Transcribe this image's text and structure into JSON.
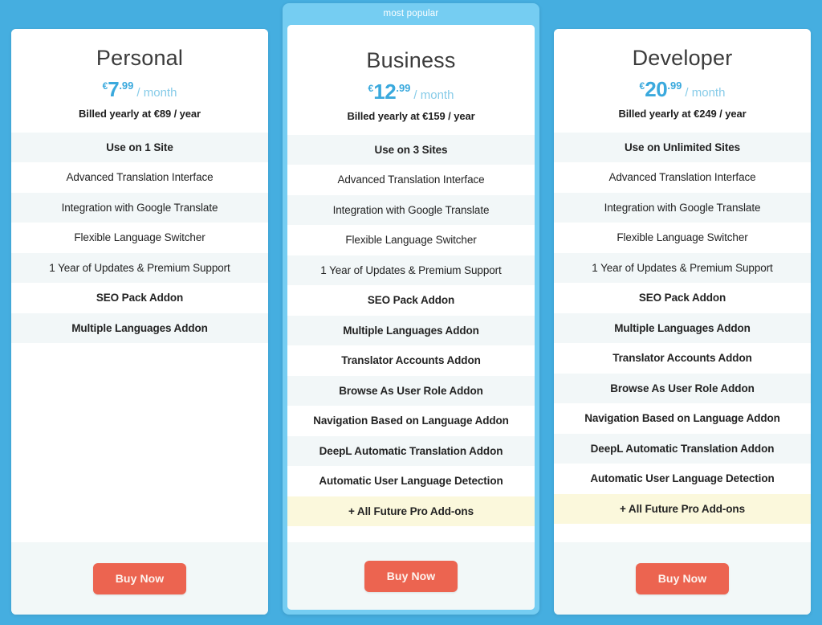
{
  "background_color": "#45aee0",
  "accent_color": "#3aa9dd",
  "buy_button_color": "#ec6450",
  "highlight_row_color": "#fbf8dc",
  "featured_frame_color": "#75cdf2",
  "plans": [
    {
      "name": "Personal",
      "featured": false,
      "badge": "",
      "currency": "€",
      "price_int": "7",
      "price_dec": ".99",
      "period": "/ month",
      "billing": "Billed yearly at €89 / year",
      "buy_label": "Buy Now",
      "features": [
        {
          "label": "Use on 1 Site",
          "bold": true,
          "highlight": false
        },
        {
          "label": "Advanced Translation Interface",
          "bold": false,
          "highlight": false
        },
        {
          "label": "Integration with Google Translate",
          "bold": false,
          "highlight": false
        },
        {
          "label": "Flexible Language Switcher",
          "bold": false,
          "highlight": false
        },
        {
          "label": "1 Year of Updates & Premium Support",
          "bold": false,
          "highlight": false
        },
        {
          "label": "SEO Pack Addon",
          "bold": true,
          "highlight": false
        },
        {
          "label": "Multiple Languages Addon",
          "bold": true,
          "highlight": false
        }
      ]
    },
    {
      "name": "Business",
      "featured": true,
      "badge": "most popular",
      "currency": "€",
      "price_int": "12",
      "price_dec": ".99",
      "period": "/ month",
      "billing": "Billed yearly at €159 / year",
      "buy_label": "Buy Now",
      "features": [
        {
          "label": "Use on 3 Sites",
          "bold": true,
          "highlight": false
        },
        {
          "label": "Advanced Translation Interface",
          "bold": false,
          "highlight": false
        },
        {
          "label": "Integration with Google Translate",
          "bold": false,
          "highlight": false
        },
        {
          "label": "Flexible Language Switcher",
          "bold": false,
          "highlight": false
        },
        {
          "label": "1 Year of Updates & Premium Support",
          "bold": false,
          "highlight": false
        },
        {
          "label": "SEO Pack Addon",
          "bold": true,
          "highlight": false
        },
        {
          "label": "Multiple Languages Addon",
          "bold": true,
          "highlight": false
        },
        {
          "label": "Translator Accounts Addon",
          "bold": true,
          "highlight": false
        },
        {
          "label": "Browse As User Role Addon",
          "bold": true,
          "highlight": false
        },
        {
          "label": "Navigation Based on Language Addon",
          "bold": true,
          "highlight": false
        },
        {
          "label": "DeepL Automatic Translation Addon",
          "bold": true,
          "highlight": false
        },
        {
          "label": "Automatic User Language Detection",
          "bold": true,
          "highlight": false
        },
        {
          "label": "+ All Future Pro Add-ons",
          "bold": true,
          "highlight": true
        }
      ]
    },
    {
      "name": "Developer",
      "featured": false,
      "badge": "",
      "currency": "€",
      "price_int": "20",
      "price_dec": ".99",
      "period": "/ month",
      "billing": "Billed yearly at €249 / year",
      "buy_label": "Buy Now",
      "features": [
        {
          "label": "Use on Unlimited Sites",
          "bold": true,
          "highlight": false
        },
        {
          "label": "Advanced Translation Interface",
          "bold": false,
          "highlight": false
        },
        {
          "label": "Integration with Google Translate",
          "bold": false,
          "highlight": false
        },
        {
          "label": "Flexible Language Switcher",
          "bold": false,
          "highlight": false
        },
        {
          "label": "1 Year of Updates & Premium Support",
          "bold": false,
          "highlight": false
        },
        {
          "label": "SEO Pack Addon",
          "bold": true,
          "highlight": false
        },
        {
          "label": "Multiple Languages Addon",
          "bold": true,
          "highlight": false
        },
        {
          "label": "Translator Accounts Addon",
          "bold": true,
          "highlight": false
        },
        {
          "label": "Browse As User Role Addon",
          "bold": true,
          "highlight": false
        },
        {
          "label": "Navigation Based on Language Addon",
          "bold": true,
          "highlight": false
        },
        {
          "label": "DeepL Automatic Translation Addon",
          "bold": true,
          "highlight": false
        },
        {
          "label": "Automatic User Language Detection",
          "bold": true,
          "highlight": false
        },
        {
          "label": "+ All Future Pro Add-ons",
          "bold": true,
          "highlight": true
        }
      ]
    }
  ]
}
